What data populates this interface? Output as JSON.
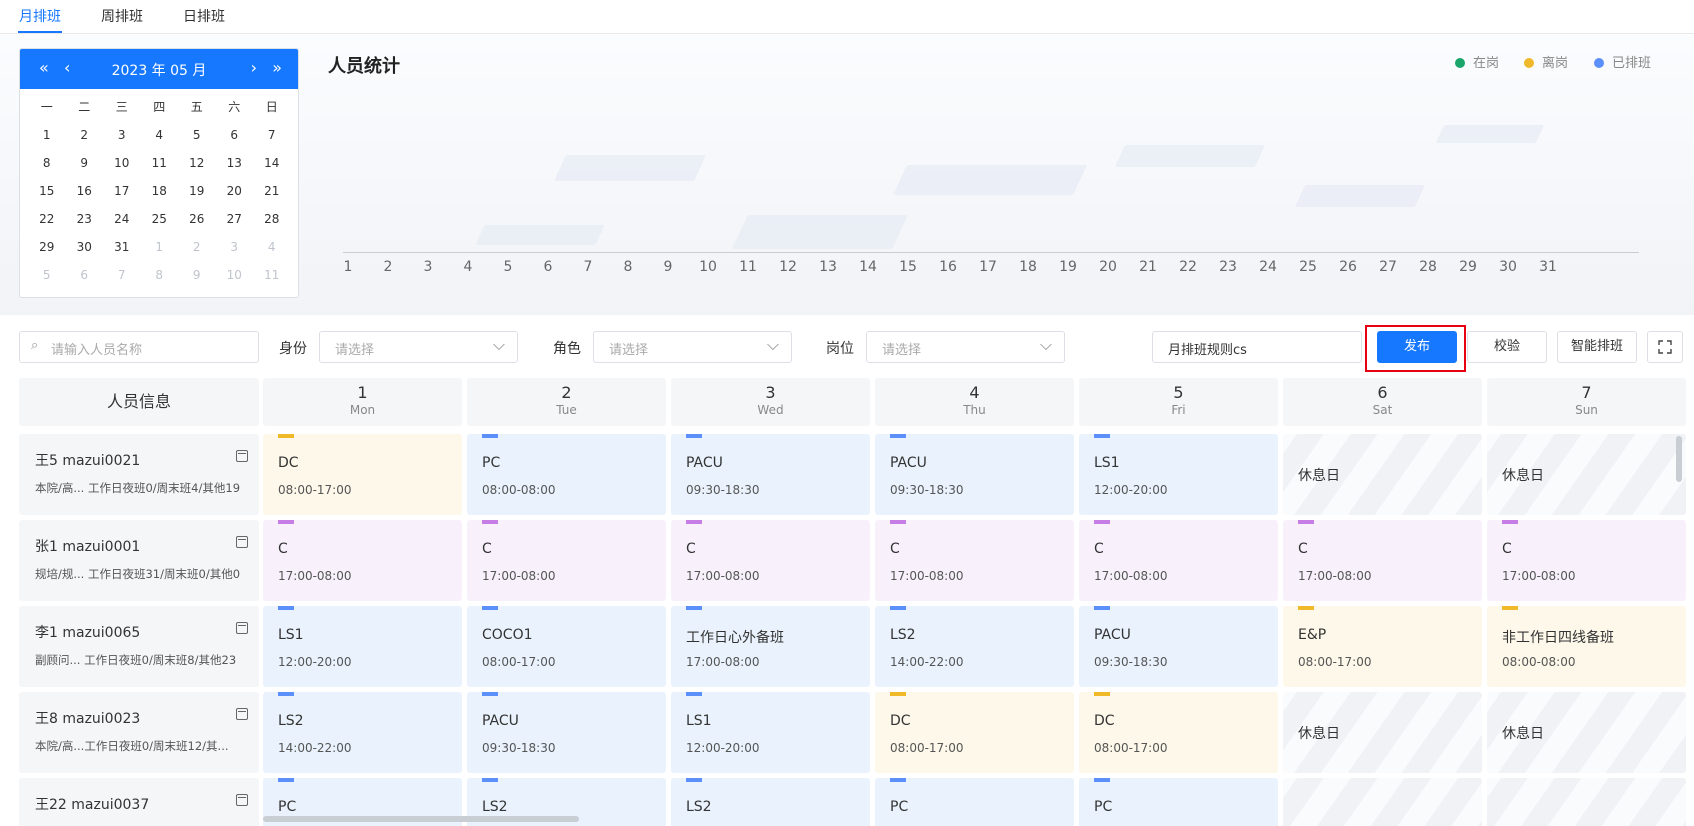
{
  "tabs": [
    {
      "label": "月排班",
      "active": true
    },
    {
      "label": "周排班",
      "active": false
    },
    {
      "label": "日排班",
      "active": false
    }
  ],
  "calendar": {
    "title": "2023 年 05 月",
    "weekdays": [
      "一",
      "二",
      "三",
      "四",
      "五",
      "六",
      "日"
    ],
    "days": [
      {
        "d": "1",
        "dim": false
      },
      {
        "d": "2",
        "dim": false
      },
      {
        "d": "3",
        "dim": false
      },
      {
        "d": "4",
        "dim": false
      },
      {
        "d": "5",
        "dim": false
      },
      {
        "d": "6",
        "dim": false
      },
      {
        "d": "7",
        "dim": false
      },
      {
        "d": "8",
        "dim": false
      },
      {
        "d": "9",
        "dim": false
      },
      {
        "d": "10",
        "dim": false
      },
      {
        "d": "11",
        "dim": false
      },
      {
        "d": "12",
        "dim": false
      },
      {
        "d": "13",
        "dim": false
      },
      {
        "d": "14",
        "dim": false
      },
      {
        "d": "15",
        "dim": false
      },
      {
        "d": "16",
        "dim": false
      },
      {
        "d": "17",
        "dim": false
      },
      {
        "d": "18",
        "dim": false
      },
      {
        "d": "19",
        "dim": false
      },
      {
        "d": "20",
        "dim": false
      },
      {
        "d": "21",
        "dim": false
      },
      {
        "d": "22",
        "dim": false
      },
      {
        "d": "23",
        "dim": false
      },
      {
        "d": "24",
        "dim": false
      },
      {
        "d": "25",
        "dim": false
      },
      {
        "d": "26",
        "dim": false
      },
      {
        "d": "27",
        "dim": false
      },
      {
        "d": "28",
        "dim": false
      },
      {
        "d": "29",
        "dim": false
      },
      {
        "d": "30",
        "dim": false
      },
      {
        "d": "31",
        "dim": false
      },
      {
        "d": "1",
        "dim": true
      },
      {
        "d": "2",
        "dim": true
      },
      {
        "d": "3",
        "dim": true
      },
      {
        "d": "4",
        "dim": true
      },
      {
        "d": "5",
        "dim": true
      },
      {
        "d": "6",
        "dim": true
      },
      {
        "d": "7",
        "dim": true
      },
      {
        "d": "8",
        "dim": true
      },
      {
        "d": "9",
        "dim": true
      },
      {
        "d": "10",
        "dim": true
      },
      {
        "d": "11",
        "dim": true
      }
    ]
  },
  "stats": {
    "title": "人员统计",
    "legend": [
      {
        "label": "在岗",
        "color": "#1aa66a"
      },
      {
        "label": "离岗",
        "color": "#f0b92a"
      },
      {
        "label": "已排班",
        "color": "#5b8ff9"
      }
    ],
    "x_labels": [
      "1",
      "2",
      "3",
      "4",
      "5",
      "6",
      "7",
      "8",
      "9",
      "10",
      "11",
      "12",
      "13",
      "14",
      "15",
      "16",
      "17",
      "18",
      "19",
      "20",
      "21",
      "22",
      "23",
      "24",
      "25",
      "26",
      "27",
      "28",
      "29",
      "30",
      "31"
    ]
  },
  "filters": {
    "search_placeholder": "请输入人员名称",
    "identity_label": "身份",
    "identity_placeholder": "请选择",
    "role_label": "角色",
    "role_placeholder": "请选择",
    "post_label": "岗位",
    "post_placeholder": "请选择",
    "rule_value": "月排班规则cs"
  },
  "actions": {
    "publish": "发布",
    "verify": "校验",
    "smart": "智能排班"
  },
  "schedule": {
    "person_header": "人员信息",
    "days": [
      {
        "num": "1",
        "dow": "Mon"
      },
      {
        "num": "2",
        "dow": "Tue"
      },
      {
        "num": "3",
        "dow": "Wed"
      },
      {
        "num": "4",
        "dow": "Thu"
      },
      {
        "num": "5",
        "dow": "Fri"
      },
      {
        "num": "6",
        "dow": "Sat"
      },
      {
        "num": "7",
        "dow": "Sun"
      }
    ],
    "rows": [
      {
        "name": "王5 mazui0021",
        "sub": "本院/高... 工作日夜班0/周末班4/其他19",
        "cells": [
          {
            "type": "yellow",
            "name": "DC",
            "time": "08:00-17:00"
          },
          {
            "type": "blue",
            "name": "PC",
            "time": "08:00-08:00"
          },
          {
            "type": "blue",
            "name": "PACU",
            "time": "09:30-18:30"
          },
          {
            "type": "blue",
            "name": "PACU",
            "time": "09:30-18:30"
          },
          {
            "type": "blue",
            "name": "LS1",
            "time": "12:00-20:00"
          },
          {
            "type": "rest",
            "name": "休息日",
            "time": ""
          },
          {
            "type": "rest",
            "name": "休息日",
            "time": ""
          }
        ]
      },
      {
        "name": "张1 mazui0001",
        "sub": "规培/规... 工作日夜班31/周末班0/其他0",
        "cells": [
          {
            "type": "purple",
            "name": "C",
            "time": "17:00-08:00"
          },
          {
            "type": "purple",
            "name": "C",
            "time": "17:00-08:00"
          },
          {
            "type": "purple",
            "name": "C",
            "time": "17:00-08:00"
          },
          {
            "type": "purple",
            "name": "C",
            "time": "17:00-08:00"
          },
          {
            "type": "purple",
            "name": "C",
            "time": "17:00-08:00"
          },
          {
            "type": "purple",
            "name": "C",
            "time": "17:00-08:00"
          },
          {
            "type": "purple",
            "name": "C",
            "time": "17:00-08:00"
          }
        ]
      },
      {
        "name": "李1 mazui0065",
        "sub": "副顾问... 工作日夜班0/周末班8/其他23",
        "cells": [
          {
            "type": "blue",
            "name": "LS1",
            "time": "12:00-20:00"
          },
          {
            "type": "blue",
            "name": "COCO1",
            "time": "08:00-17:00"
          },
          {
            "type": "blue",
            "name": "工作日心外备班",
            "time": "17:00-08:00"
          },
          {
            "type": "blue",
            "name": "LS2",
            "time": "14:00-22:00"
          },
          {
            "type": "blue",
            "name": "PACU",
            "time": "09:30-18:30"
          },
          {
            "type": "yellow",
            "name": "E&P",
            "time": "08:00-17:00"
          },
          {
            "type": "yellow",
            "name": "非工作日四线备班",
            "time": "08:00-08:00"
          }
        ]
      },
      {
        "name": "王8 mazui0023",
        "sub": "本院/高...工作日夜班0/周末班12/其...",
        "cells": [
          {
            "type": "blue",
            "name": "LS2",
            "time": "14:00-22:00"
          },
          {
            "type": "blue",
            "name": "PACU",
            "time": "09:30-18:30"
          },
          {
            "type": "blue",
            "name": "LS1",
            "time": "12:00-20:00"
          },
          {
            "type": "yellow",
            "name": "DC",
            "time": "08:00-17:00"
          },
          {
            "type": "yellow",
            "name": "DC",
            "time": "08:00-17:00"
          },
          {
            "type": "rest",
            "name": "休息日",
            "time": ""
          },
          {
            "type": "rest",
            "name": "休息日",
            "time": ""
          }
        ]
      },
      {
        "name": "王22 mazui0037",
        "sub": "",
        "cells": [
          {
            "type": "blue",
            "name": "PC",
            "time": ""
          },
          {
            "type": "blue",
            "name": "LS2",
            "time": ""
          },
          {
            "type": "blue",
            "name": "LS2",
            "time": ""
          },
          {
            "type": "blue",
            "name": "PC",
            "time": ""
          },
          {
            "type": "blue",
            "name": "PC",
            "time": ""
          },
          {
            "type": "rest",
            "name": "",
            "time": ""
          },
          {
            "type": "rest",
            "name": "",
            "time": ""
          }
        ]
      }
    ]
  }
}
